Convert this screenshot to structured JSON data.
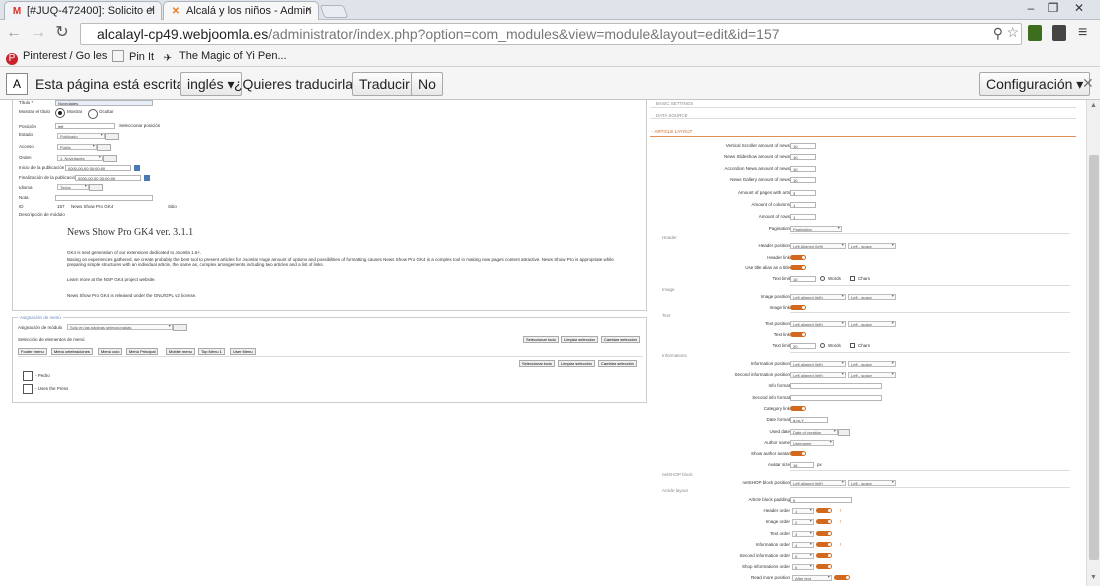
{
  "browser": {
    "tabs": [
      {
        "title": "[#JUQ-472400]: Solicito el",
        "favicon": "M"
      },
      {
        "title": "Alcalá y los niños - Admin",
        "favicon": "✕"
      }
    ],
    "url_host": "alcalayl-cp49.webjoomla.es",
    "url_path": "/administrator/index.php?option=com_modules&view=module&layout=edit&id=157",
    "bookmarks": [
      "Pinterest / Go   les",
      "Pin It",
      "The Magic of Yi Pen..."
    ]
  },
  "translate": {
    "prefix": "Esta página está escrita en",
    "language": "inglés",
    "question": "¿Quieres traducirla?",
    "translate_button": "Traducir",
    "no_button": "No",
    "settings_button": "Configuración"
  },
  "module_form": {
    "title_label": "Título *",
    "title_value": "Novedades",
    "show_title_label": "Mostrar el título",
    "show_option": "Mostrar",
    "hide_option": "Ocultar",
    "position_label": "Posición",
    "position_value": "left",
    "position_button": "Seleccionar posición",
    "status_label": "Estado",
    "status_value": "Publicado",
    "access_label": "Acceso",
    "access_value": "Public",
    "order_label": "Orden",
    "order_value": "1. Novedades",
    "publish_start_label": "Inicio de la publicación",
    "publish_start_value": "0000-00-00 00:00:00",
    "publish_end_label": "Finalización de la publicación",
    "publish_end_value": "0000-00-00 00:00:00",
    "language_label": "Idioma",
    "language_value": "Todos",
    "note_label": "Nota",
    "id_label": "ID",
    "id_value": "157",
    "module_type": "News Show Pro GK4",
    "site": "Sitio",
    "desc_label": "Descripción de módulo",
    "desc_title": "News Show Pro GK4 ver. 3.1.1",
    "desc_p1": "GK4 is next generation of our extensions dedicated to Joomla 1.6+.",
    "desc_p2": "Basing on experiences gathered, we create probably the best tool to present articles for Joomla! Huge amount of options and possibilities of formatting causes News Show Pro GK4 is a complex tool in making new pages content attractive. News Show Pro is appropriate while preparing simple structures with an individual article, the same as, complex arrangements including two articles and a list of links.",
    "desc_p3": "Learn more at the NSP GK4 project website.",
    "desc_p4": "News Show Pro GK4 is released under the GNU/GPL v2 license."
  },
  "menu_assignment": {
    "legend": "Asignación de menú",
    "assign_label": "Asignación de módulo",
    "assign_value": "Solo en las páginas seleccionadas",
    "select_label": "Selección de elementos de menú",
    "buttons": [
      "Seleccionar todo",
      "Limpiar selección",
      "Cambiar selección"
    ],
    "menu_tabs": [
      "Footer menu",
      "Menú celebraciones",
      "Menú ocio",
      "Menú Principal",
      "Mobile menu",
      "Top Menu 1",
      "User Menu"
    ],
    "items": [
      "- Pedro",
      "- Uses the Press"
    ]
  },
  "right_panel": {
    "accordions": [
      "BASIC SETTINGS",
      "DATA SOURCE",
      "- ARTICLE LAYOUT"
    ],
    "fields": [
      {
        "label": "Vertical Scroller amount of news",
        "value": "10"
      },
      {
        "label": "News Slideshow amount of news",
        "value": "10"
      },
      {
        "label": "Accordion News amount of news",
        "value": "10"
      },
      {
        "label": "News Gallery amount of news",
        "value": "10"
      },
      {
        "label": "Amount of pages with arts",
        "value": "3"
      },
      {
        "label": "Amount of columns",
        "value": "1"
      },
      {
        "label": "Amount of rows",
        "value": "1"
      }
    ],
    "pagination_label": "Pagination",
    "pagination_value": "Pagination",
    "header_section": "Header",
    "header_position_label": "Header position",
    "header_position_value": "Left Aligned (left)",
    "header_position_value2": "Left - space",
    "header_link_label": "Header link",
    "use_title_alias_label": "Use title alias as a title",
    "text_limit_label": "Text limit",
    "text_limit_value": "10",
    "words": "Words",
    "chars": "Chars",
    "image_section": "Image",
    "image_position_label": "Image position",
    "image_position_value": "Left aligned (left)",
    "image_position_value2": "Left - space",
    "image_link_label": "Image link",
    "text_section": "Text",
    "text_position_label": "Text position",
    "text_position_value": "Left aligned (left)",
    "text_position_value2": "Left - space",
    "text_link_label": "Text link",
    "text_limit2_value": "20",
    "info_section": "Informations",
    "info_position_label": "Information position",
    "info_position_value": "Left aligned (left)",
    "info_position_value2": "Left - space",
    "second_info_position_label": "Second information position",
    "second_info_position_value": "Left aligned (left)",
    "second_info_position_value2": "Left - space",
    "info_format_label": "Info format",
    "second_info_format_label": "Second info format",
    "category_link_label": "Category link",
    "date_format_label": "Date format",
    "date_format_value": "d-m-Y",
    "used_date_label": "Used date",
    "used_date_value": "Date of creation",
    "author_name_label": "Author name",
    "author_name_value": "Username",
    "show_author_avatar_label": "Show author avatar",
    "avatar_size_label": "Avatar size",
    "avatar_size_value": "16",
    "px": "px",
    "netshop_section": "netSHOP block",
    "netshop_position_label": "netSHOP block position",
    "netshop_position_value": "Left aligned (left)",
    "netshop_position_value2": "Left - space",
    "article_layout_section": "Article layout",
    "article_block_padding_label": "Article block padding",
    "article_block_padding_value": "0",
    "orders": [
      {
        "label": "Header order",
        "value": "1"
      },
      {
        "label": "Image order",
        "value": "2"
      },
      {
        "label": "Text order",
        "value": "3"
      },
      {
        "label": "Information order",
        "value": "4"
      },
      {
        "label": "Second information order",
        "value": "5"
      },
      {
        "label": "Shop informations order",
        "value": "6"
      }
    ],
    "read_more_label": "Read more position",
    "read_more_value": "After text"
  },
  "colors": {
    "accent": "#d2691e",
    "tab_bg": "#dfe3ea",
    "translate_bg": "#f5f5f5"
  }
}
